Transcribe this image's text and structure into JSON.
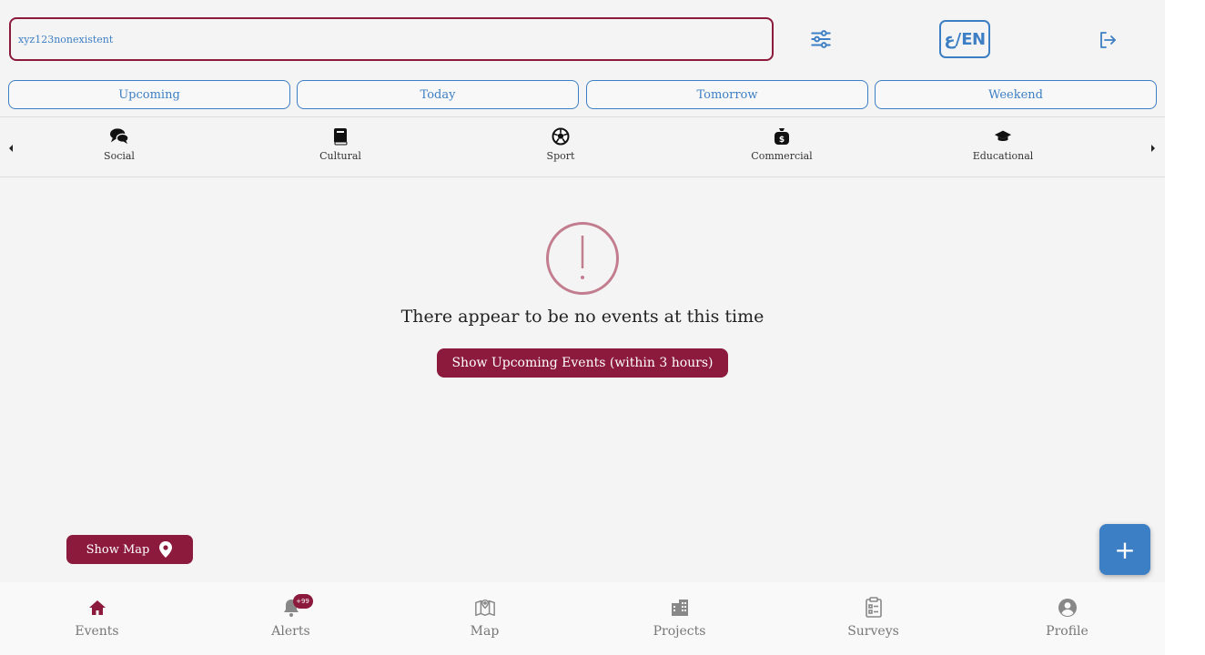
{
  "search": {
    "value": "xyz123nonexistent"
  },
  "header": {
    "lang_label": "ع/EN"
  },
  "time_filters": [
    "Upcoming",
    "Today",
    "Tomorrow",
    "Weekend"
  ],
  "categories": [
    {
      "label": "Social",
      "icon": "comments-icon"
    },
    {
      "label": "Cultural",
      "icon": "book-icon"
    },
    {
      "label": "Sport",
      "icon": "football-icon"
    },
    {
      "label": "Commercial",
      "icon": "money-bag-icon"
    },
    {
      "label": "Educational",
      "icon": "graduation-cap-icon"
    }
  ],
  "empty_state": {
    "message": "There appear to be no events at this time",
    "button_label": "Show Upcoming Events (within 3 hours)"
  },
  "show_map": {
    "label": "Show Map"
  },
  "fab": {
    "label": "+"
  },
  "nav": [
    {
      "label": "Events",
      "icon": "home-icon"
    },
    {
      "label": "Alerts",
      "icon": "bell-icon",
      "badge": "+99"
    },
    {
      "label": "Map",
      "icon": "map-icon"
    },
    {
      "label": "Projects",
      "icon": "building-icon"
    },
    {
      "label": "Surveys",
      "icon": "clipboard-icon"
    },
    {
      "label": "Profile",
      "icon": "user-circle-icon"
    }
  ],
  "colors": {
    "primary": "#8b1a3c",
    "accent": "#3d7fc4",
    "background": "#f4f4f4"
  }
}
